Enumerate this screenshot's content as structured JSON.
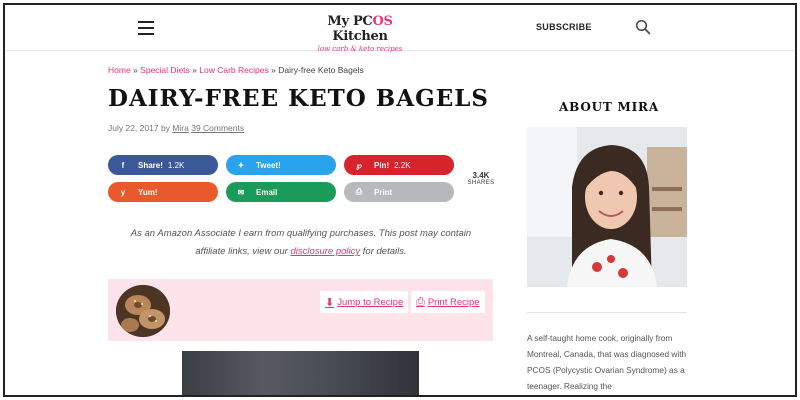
{
  "header": {
    "logo_main_prefix": "My PC",
    "logo_main_os": "OS",
    "logo_main_suffix": " Kitchen",
    "logo_sub": "low carb & keto recipes",
    "subscribe_label": "SUBSCRIBE",
    "menu_icon": "hamburger-icon",
    "search_icon": "search-icon"
  },
  "breadcrumb": {
    "items": [
      "Home",
      "Special Diets",
      "Low Carb Recipes"
    ],
    "separator": "»",
    "current": "Dairy-free Keto Bagels"
  },
  "post": {
    "title": "DAIRY-FREE KETO BAGELS",
    "date": "July 22, 2017",
    "by": "by",
    "author": "Mira",
    "comments": "39 Comments"
  },
  "share": {
    "facebook": {
      "label": "Share!",
      "count": "1.2K",
      "icon": "facebook-icon"
    },
    "twitter": {
      "label": "Tweet!",
      "count": "",
      "icon": "twitter-icon"
    },
    "pinterest": {
      "label": "Pin!",
      "count": "2.2K",
      "icon": "pinterest-icon"
    },
    "yummly": {
      "label": "Yum!",
      "count": "",
      "icon": "yummly-icon"
    },
    "email": {
      "label": "Email",
      "count": "",
      "icon": "email-icon"
    },
    "print": {
      "label": "Print",
      "count": "",
      "icon": "print-icon"
    },
    "total_count": "3.4K",
    "total_label": "SHARES"
  },
  "disclosure": {
    "text_before": "As an Amazon Associate I earn from qualifying purchases. This post may contain affiliate links, view our ",
    "link": "disclosure policy",
    "text_after": " for details."
  },
  "recipe_box": {
    "jump_label": "Jump to Recipe",
    "print_label": "Print Recipe"
  },
  "sidebar": {
    "about_title": "ABOUT MIRA",
    "bio": "A self-taught home cook, originally from Montreal, Canada, that was diagnosed with PCOS (Polycystic Ovarian Syndrome) as a teenager. Realizing the"
  },
  "colors": {
    "accent": "#e6337a",
    "facebook": "#3b5998",
    "twitter": "#2aa3ef",
    "pinterest": "#d6232c",
    "yummly": "#e9592b",
    "email": "#1a9b5a",
    "print": "#b6b9bd",
    "recipe_box_bg": "#fde3ea"
  }
}
